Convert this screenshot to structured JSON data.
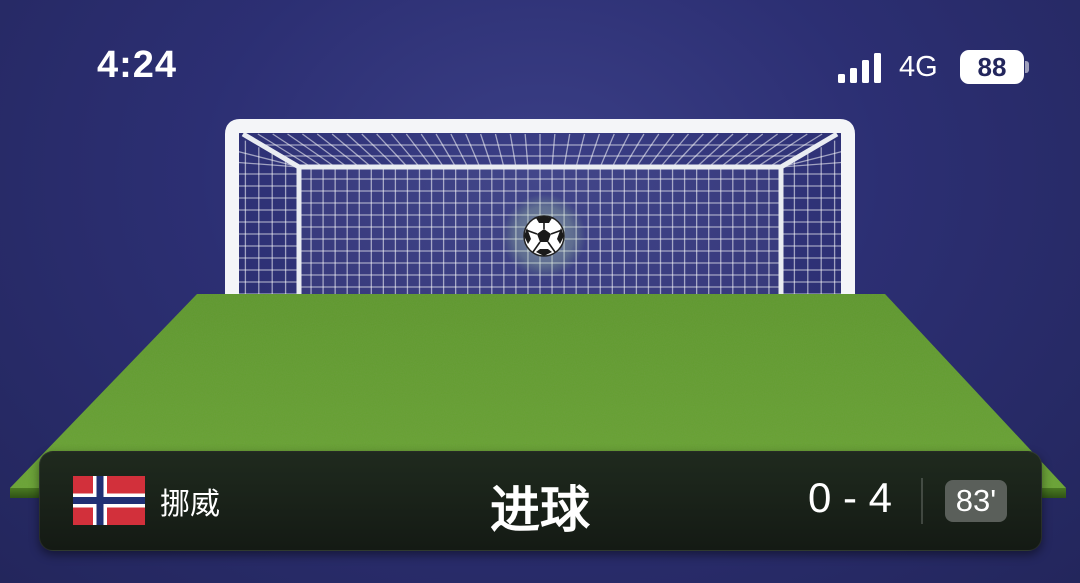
{
  "status_bar": {
    "time": "4:24",
    "network": "4G",
    "battery": "88"
  },
  "event": {
    "team": "挪威",
    "flag_icon": "norway-flag-icon",
    "title": "进球",
    "score": "0 - 4",
    "minute": "83'"
  },
  "colors": {
    "background": "#2c2f73",
    "grass": "#5f9a2c",
    "scorebar": "#161c16",
    "minute_badge": "#5a5f5a",
    "norway_red": "#d2303b",
    "norway_blue": "#1f2f74"
  }
}
